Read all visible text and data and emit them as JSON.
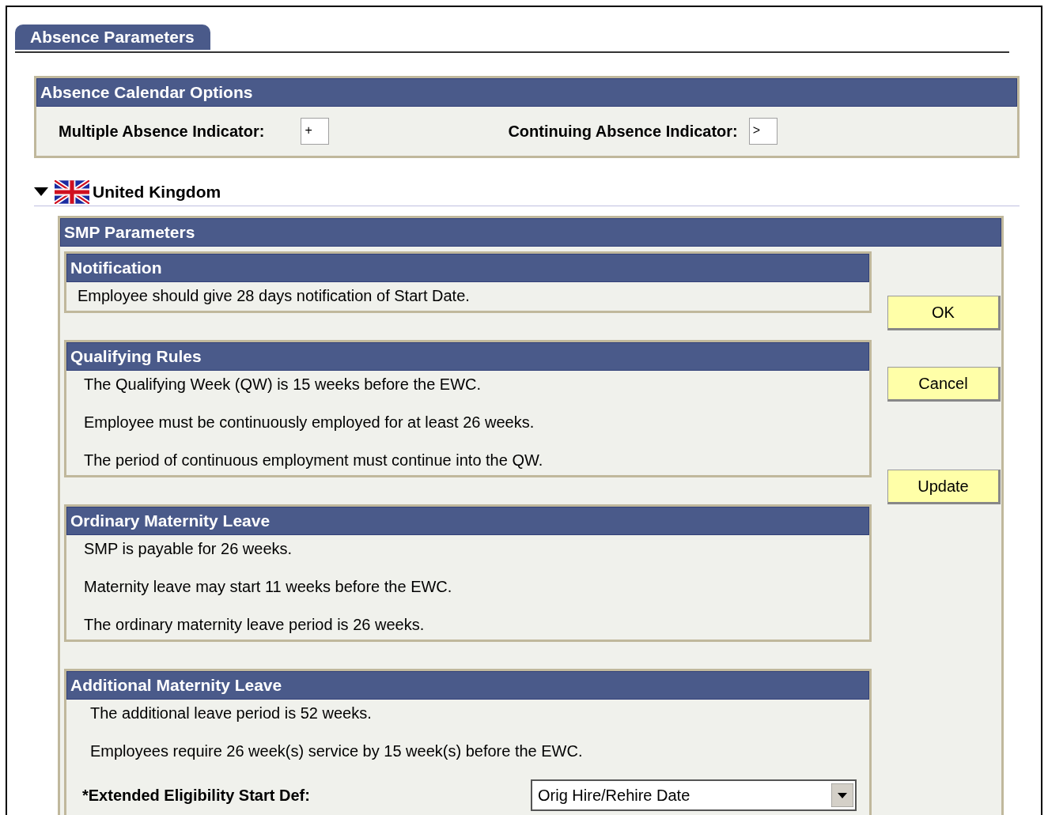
{
  "tab": {
    "label": "Absence Parameters",
    "selected": true
  },
  "calendar_options": {
    "title": "Absence Calendar Options",
    "fields": [
      {
        "label": "Multiple Absence Indicator:",
        "value": "+"
      },
      {
        "label": "Continuing Absence Indicator:",
        "value": ">"
      }
    ]
  },
  "country": {
    "label": "United Kingdom",
    "expanded": true
  },
  "smp": {
    "title": "SMP Parameters",
    "sections": [
      {
        "title": "Notification",
        "lines": [
          "Employee should give 28 days notification of Start Date."
        ]
      },
      {
        "title": "Qualifying Rules",
        "lines": [
          "The Qualifying Week (QW) is 15 weeks before the EWC.",
          "Employee must be continuously employed for at least 26 weeks.",
          "The period of continuous employment must continue into the QW."
        ]
      },
      {
        "title": "Ordinary Maternity Leave",
        "lines": [
          "SMP is payable for 26 weeks.",
          "Maternity leave may start 11 weeks before the EWC.",
          "The ordinary maternity leave period is 26 weeks."
        ]
      },
      {
        "title": "Additional Maternity Leave",
        "lines": [
          "The additional leave period is 52 weeks.",
          "Employees require 26 week(s) service by 15 week(s) before the EWC."
        ],
        "field": {
          "label": "*Extended Eligibility Start Def:",
          "value": "Orig Hire/Rehire Date"
        }
      }
    ],
    "buttons": [
      "OK",
      "Cancel",
      "Update"
    ]
  }
}
